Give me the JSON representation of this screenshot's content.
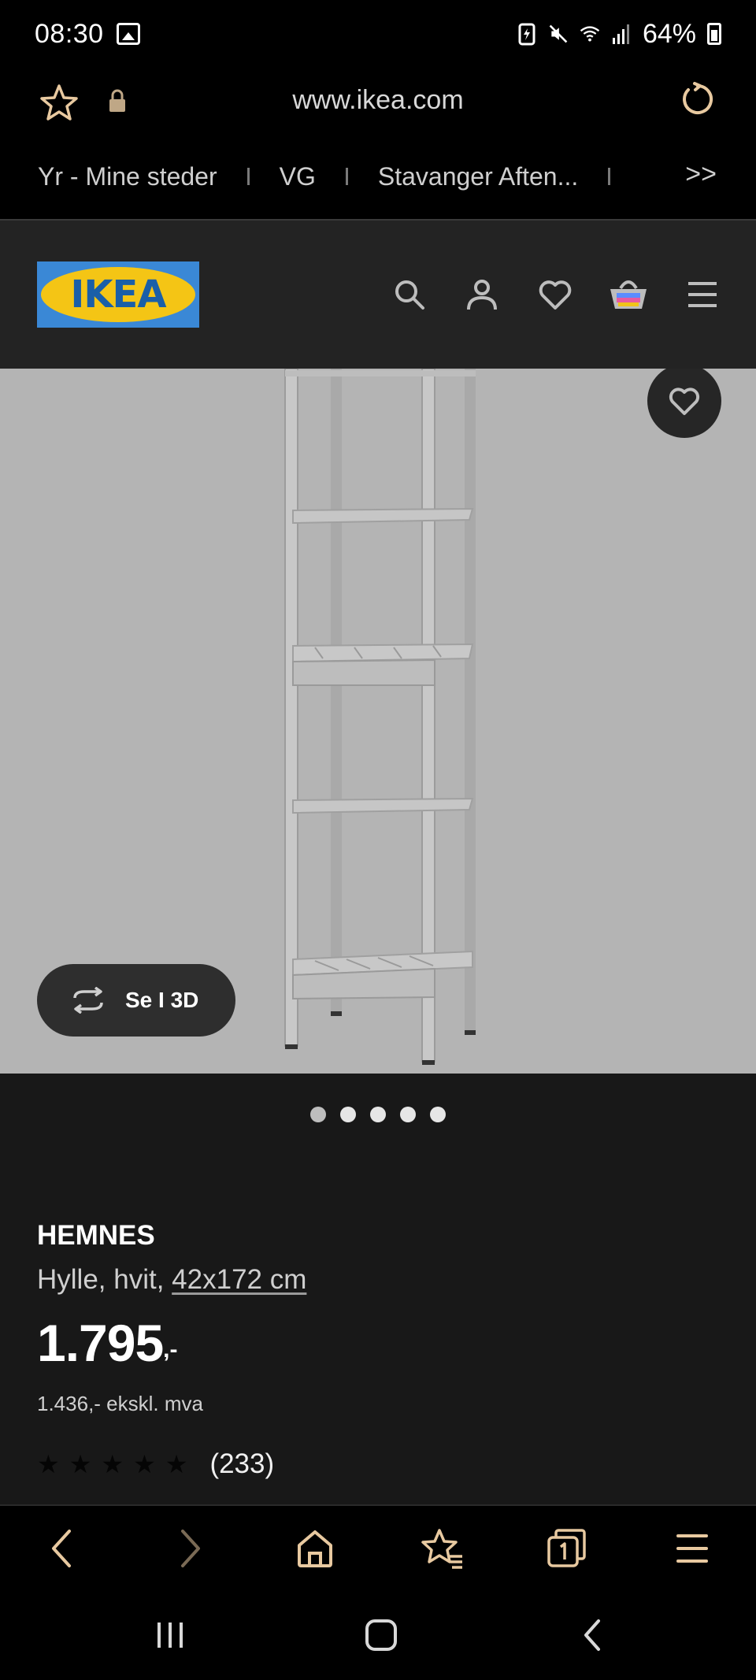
{
  "status_bar": {
    "time": "08:30",
    "battery": "64%"
  },
  "browser": {
    "url": "www.ikea.com",
    "bookmarks": [
      "Yr - Mine steder",
      "VG",
      "Stavanger Aften..."
    ],
    "more_label": ">>"
  },
  "header": {
    "logo_text": "IKEA"
  },
  "product": {
    "view_3d_label": "Se I 3D",
    "carousel_count": 5,
    "carousel_active": 0,
    "name": "HEMNES",
    "description": "Hylle, hvit,",
    "size": "42x172 cm",
    "price": "1.795",
    "price_suffix": ",-",
    "price_ex_vat": "1.436,- ekskl. mva",
    "rating_stars": 5,
    "review_count": "(233)"
  },
  "colors": {
    "accent_browser": "#e8c9a0",
    "ikea_blue": "#3a88d6",
    "ikea_yellow": "#f4c515"
  }
}
